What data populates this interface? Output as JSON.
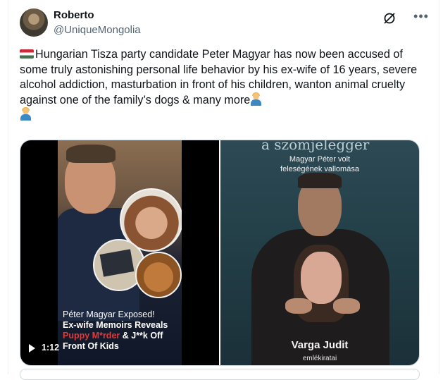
{
  "user": {
    "name": "Roberto",
    "handle": "@UniqueMongolia"
  },
  "icons": {
    "grok": "grok-icon",
    "more": "more-options-icon",
    "flag": "hungary-flag-icon",
    "person_emoji": "person-shrugging-icon",
    "play": "play-icon"
  },
  "tweet": {
    "text": "Hungarian Tisza party candidate Peter Magyar has now been accused of some truly astonishing personal life behavior by his ex-wife of 16 years, severe alcohol addiction, masturbation in front of his children, wanton animal cruelty against one of the family’s dogs & many more"
  },
  "video": {
    "caption_line1": "Péter Magyar Exposed!",
    "caption_line2": "Ex-wife Memoirs Reveals",
    "caption_red": "Puppy M*rder",
    "caption_line3_rest": " & J**k Off",
    "caption_line4": "Front Of Kids",
    "duration": "1:12"
  },
  "book": {
    "title_fragment": "a szomjelegger",
    "subtitle_line1": "Magyar Péter volt",
    "subtitle_line2": "feleségének vallomása",
    "author": "Varga Judit",
    "series": "emlékiratai"
  },
  "colors": {
    "text": "#0f1419",
    "muted": "#536471",
    "border": "#cfd9de",
    "caption_red": "#e23a3a"
  }
}
